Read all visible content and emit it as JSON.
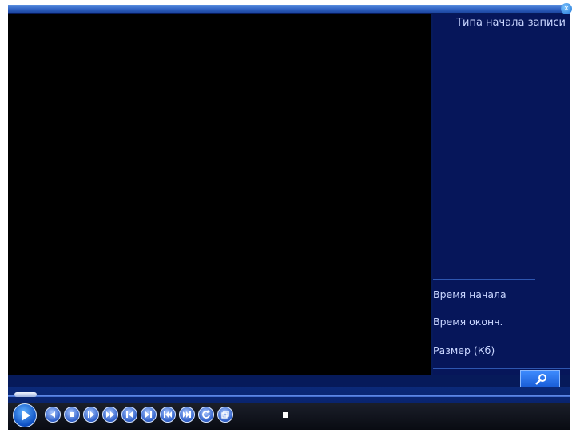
{
  "window": {
    "close_label": "x"
  },
  "sidebar": {
    "header": "Типа начала записи",
    "info": {
      "start_label": "Время начала",
      "end_label": "Время оконч.",
      "size_label": "Размер (Кб)"
    }
  },
  "controls": {
    "playback_progress": 0.0,
    "buttons": [
      "play-icon",
      "reverse-play-icon",
      "stop-icon",
      "slow-play-icon",
      "fast-forward-icon",
      "previous-frame-icon",
      "next-frame-icon",
      "previous-file-icon",
      "next-file-icon",
      "refresh-icon",
      "window-mode-icon",
      "stop-indicator-icon"
    ]
  },
  "colors": {
    "window_bg": "#061a5a",
    "accent_blue": "#2f62c2",
    "text": "#c9d6ff"
  }
}
